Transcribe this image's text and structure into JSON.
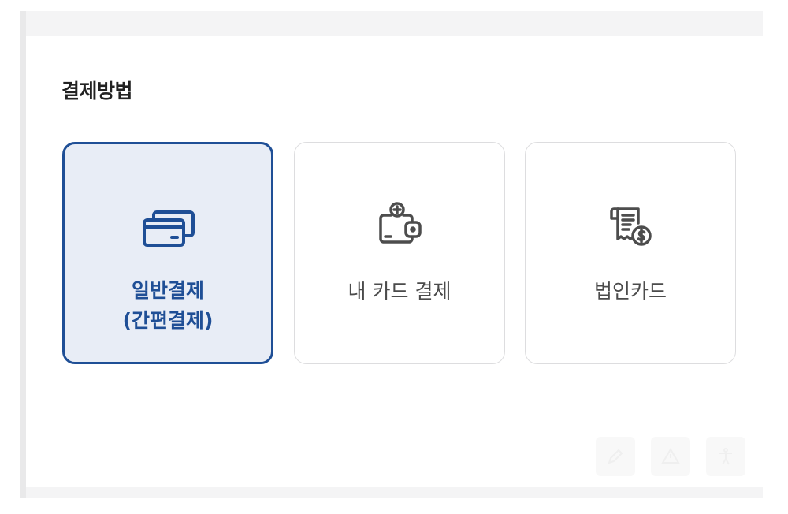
{
  "section": {
    "title": "결제방법"
  },
  "payment_options": [
    {
      "id": "general",
      "icon": "credit-card-icon",
      "label_line1": "일반결제",
      "label_line2": "(간편결제)",
      "selected": true
    },
    {
      "id": "my-card",
      "icon": "wallet-plus-icon",
      "label_line1": "내 카드 결제",
      "selected": false
    },
    {
      "id": "corporate",
      "icon": "receipt-dollar-icon",
      "label_line1": "법인카드",
      "selected": false
    }
  ],
  "colors": {
    "accent": "#1f4f96",
    "selected_bg": "#e8edf6",
    "card_border": "#dddddf",
    "icon_gray": "#4d4d4d",
    "text_gray": "#4b4b4b",
    "title": "#222222"
  },
  "faint_icons": [
    "edit-icon",
    "warning-icon",
    "accessibility-icon"
  ]
}
